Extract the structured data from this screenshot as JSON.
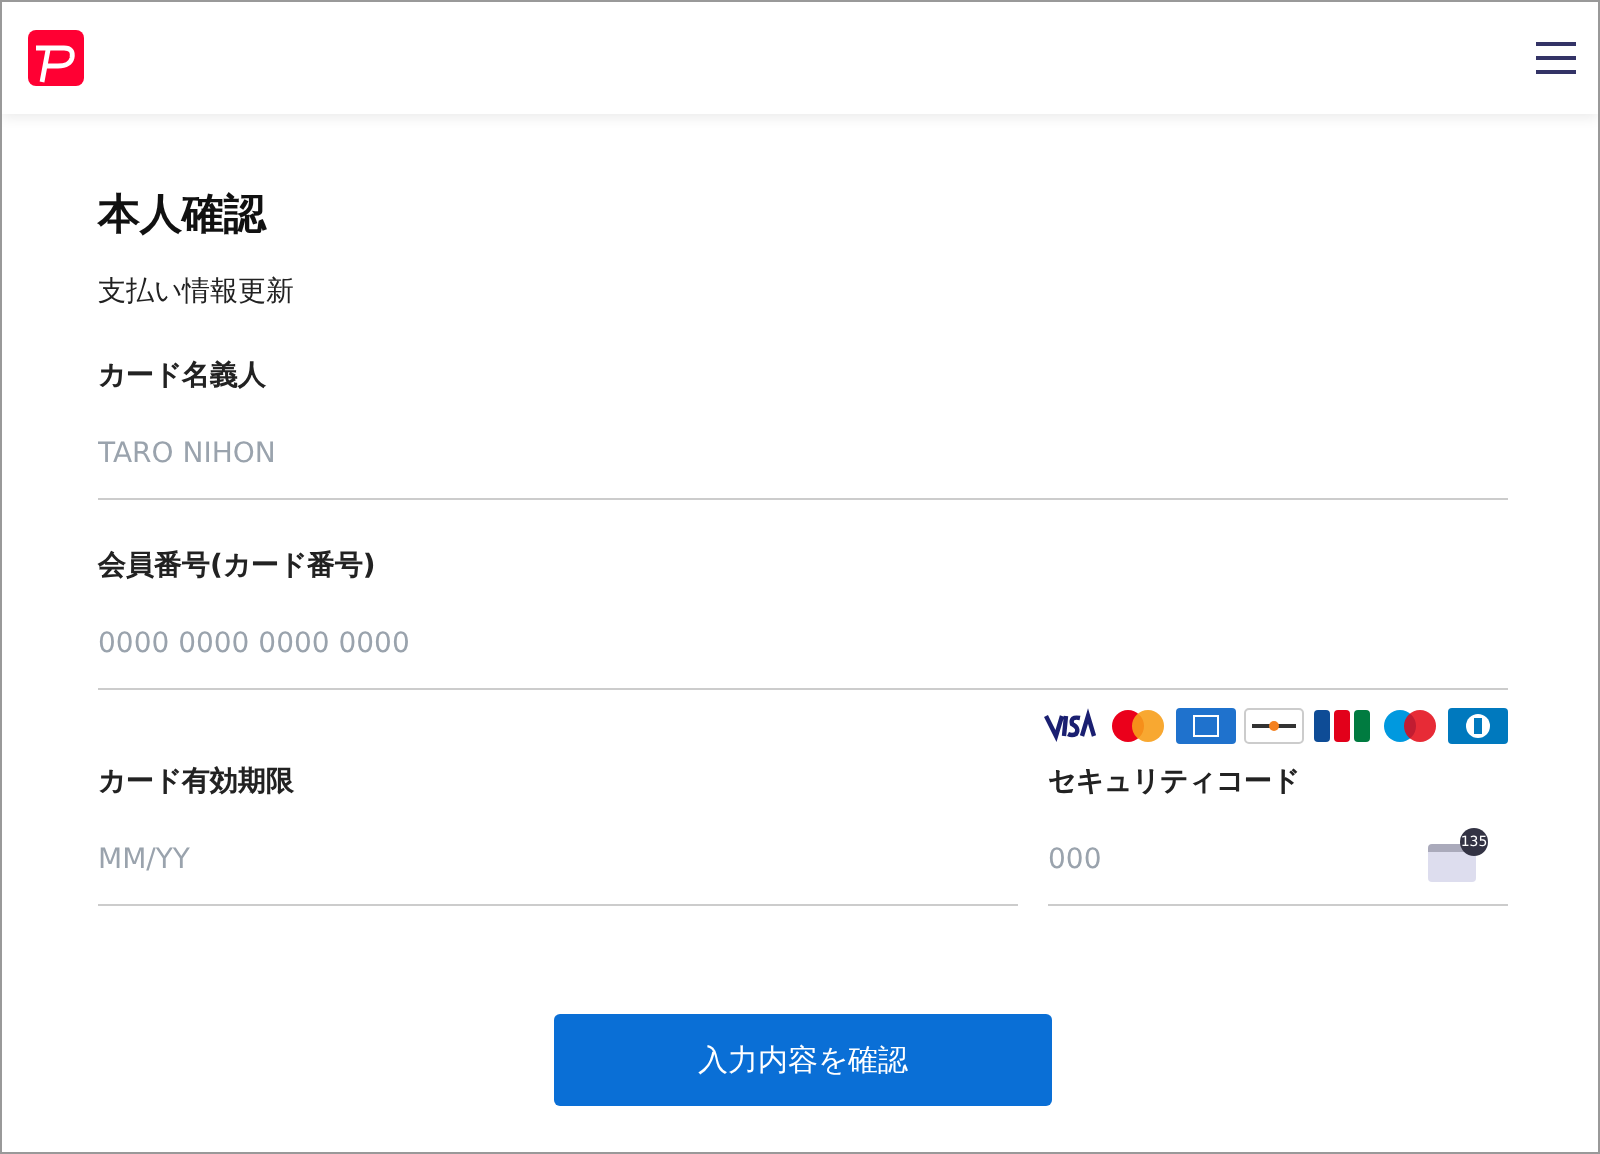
{
  "title": "本人確認",
  "subtitle": "支払い情報更新",
  "fields": [
    {
      "label": "カード名義人",
      "placeholder": "TARO NIHON"
    },
    {
      "label": "会員番号(カード番号)",
      "placeholder": "0000 0000 0000 0000"
    }
  ],
  "card_brands": [
    {
      "kind": "visa"
    },
    {
      "kind": "mastercard"
    },
    {
      "kind": "amex"
    },
    {
      "kind": "discover"
    },
    {
      "kind": "jcb"
    },
    {
      "kind": "maestro"
    },
    {
      "kind": "diners"
    }
  ],
  "expiry": {
    "label": "カード有効期限",
    "placeholder": "MM/YY"
  },
  "security": {
    "label": "セキュリティコード",
    "placeholder": "000",
    "hint": "135"
  },
  "button": "入力内容を確認"
}
